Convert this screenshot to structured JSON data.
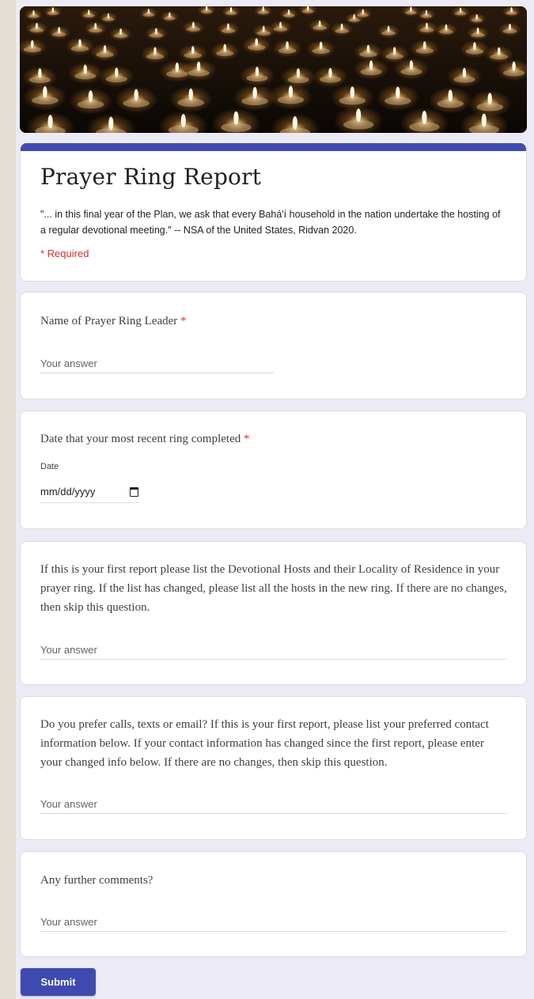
{
  "form": {
    "title": "Prayer Ring Report",
    "description": "\"... in this final year of the Plan, we ask that every Bahá'í  household in the nation undertake the hosting of a regular devotional meeting.\" -- NSA of the United States, Ridvan 2020.",
    "required_note": "* Required",
    "accent_color": "#3f4ab0",
    "required_color": "#d93025"
  },
  "questions": [
    {
      "label": "Name of Prayer Ring Leader",
      "required_mark": "*",
      "placeholder": "Your answer"
    },
    {
      "label": "Date that your most recent ring completed",
      "required_mark": "*",
      "sub_label": "Date",
      "placeholder": "mm/dd/yyyy",
      "icon": "calendar-icon"
    },
    {
      "label": "If this is your first report please list the Devotional Hosts and their Locality of Residence in your prayer ring. If the list has changed, please list all the hosts in the new ring. If there are no changes, then skip this question.",
      "placeholder": "Your answer"
    },
    {
      "label": "Do you prefer calls, texts or email? If this is your first report, please list your preferred contact information below. If your contact information has changed since the first report, please enter your changed info below. If there are no changes, then skip this question.",
      "placeholder": "Your answer"
    },
    {
      "label": "Any further comments?",
      "placeholder": "Your answer"
    }
  ],
  "submit_label": "Submit"
}
